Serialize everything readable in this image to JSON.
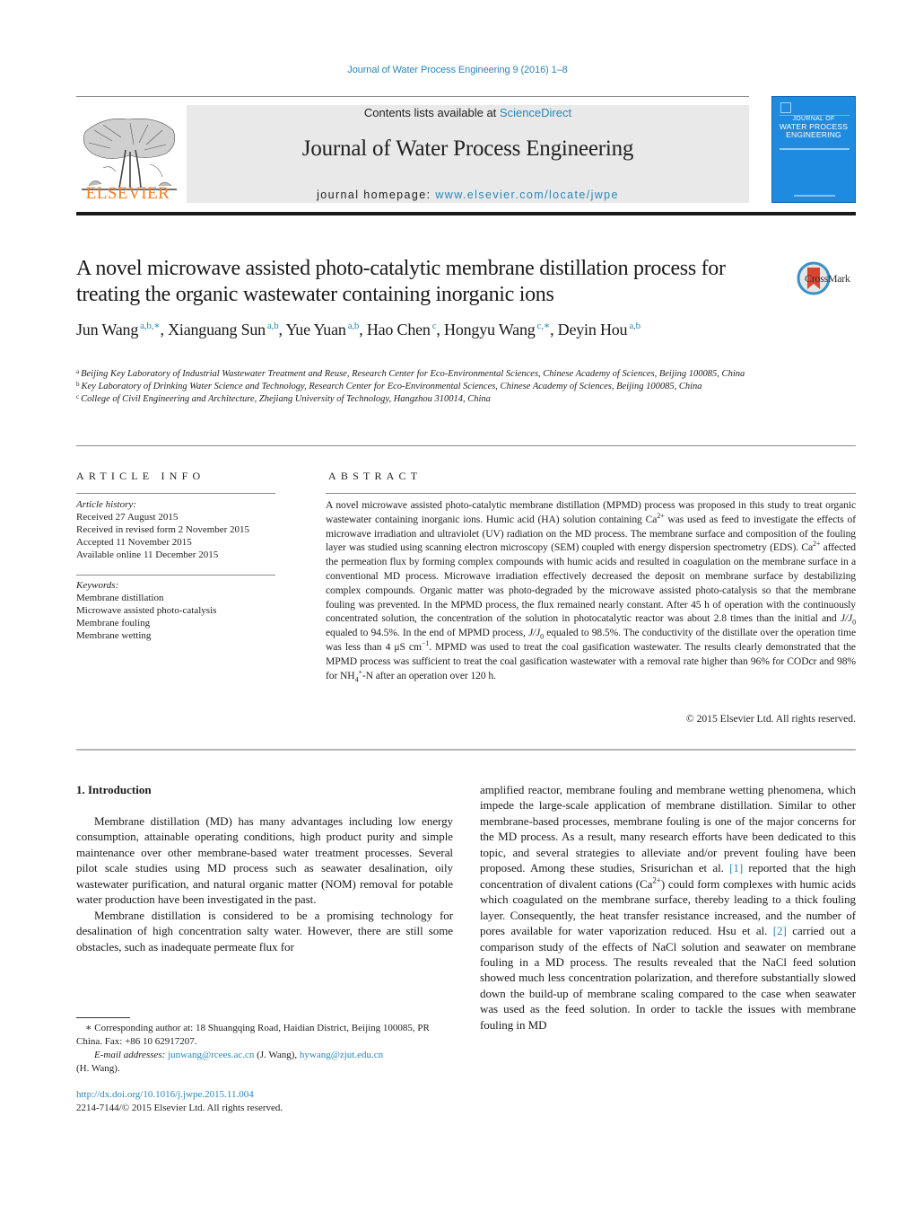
{
  "header": {
    "running_head": "Journal of Water Process Engineering 9 (2016) 1–8",
    "contents_prefix": "Contents lists available at ",
    "contents_link": "ScienceDirect",
    "journal_name": "Journal of Water Process Engineering",
    "homepage_prefix": "journal homepage: ",
    "homepage_link": "www.elsevier.com/locate/jwpe",
    "publisher_logo_text": "ELSEVIER",
    "cover": {
      "line1": "JOURNAL OF",
      "line2": "WATER PROCESS",
      "line3": "ENGINEERING",
      "color": "#1f8be0"
    },
    "publisher_color": "#f07e26",
    "link_color": "#2a86b8"
  },
  "article": {
    "title": "A novel microwave assisted photo-catalytic membrane distillation process for treating the organic wastewater containing inorganic ions",
    "crossmark_label": "CrossMark",
    "authors": [
      {
        "name": "Jun Wang",
        "sup": "a,b,∗"
      },
      {
        "name": "Xianguang Sun",
        "sup": "a,b"
      },
      {
        "name": "Yue Yuan",
        "sup": "a,b"
      },
      {
        "name": "Hao Chen",
        "sup": "c"
      },
      {
        "name": "Hongyu Wang",
        "sup": "c,∗"
      },
      {
        "name": "Deyin Hou",
        "sup": "a,b"
      }
    ],
    "affiliations": [
      {
        "mark": "a",
        "text": "Beijing Key Laboratory of Industrial Wastewater Treatment and Reuse, Research Center for Eco-Environmental Sciences, Chinese Academy of Sciences, Beijing 100085, China"
      },
      {
        "mark": "b",
        "text": "Key Laboratory of Drinking Water Science and Technology, Research Center for Eco-Environmental Sciences, Chinese Academy of Sciences, Beijing 100085, China"
      },
      {
        "mark": "c",
        "text": "College of Civil Engineering and Architecture, Zhejiang University of Technology, Hangzhou 310014, China"
      }
    ]
  },
  "article_info": {
    "heading": "ARTICLE INFO",
    "history_label": "Article history:",
    "history": [
      "Received 27 August 2015",
      "Received in revised form 2 November 2015",
      "Accepted 11 November 2015",
      "Available online 11 December 2015"
    ],
    "keywords_label": "Keywords:",
    "keywords": [
      "Membrane distillation",
      "Microwave assisted photo-catalysis",
      "Membrane fouling",
      "Membrane wetting"
    ]
  },
  "abstract": {
    "heading": "ABSTRACT",
    "parts": {
      "p1": "A novel microwave assisted photo-catalytic membrane distillation (MPMD) process was proposed in this study to treat organic wastewater containing inorganic ions. Humic acid (HA) solution containing Ca",
      "sup1": "2+",
      "p2": " was used as feed to investigate the effects of microwave irradiation and ultraviolet (UV) radiation on the MD process. The membrane surface and composition of the fouling layer was studied using scanning electron microscopy (SEM) coupled with energy dispersion spectrometry (EDS). Ca",
      "sup2": "2+",
      "p3": " affected the permeation flux by forming complex compounds with humic acids and resulted in coagulation on the membrane surface in a conventional MD process. Microwave irradiation effectively decreased the deposit on membrane surface by destabilizing complex compounds. Organic matter was photo-degraded by the microwave assisted photo-catalysis so that the membrane fouling was prevented. In the MPMD process, the flux remained nearly constant. After 45 h of operation with the continuously concentrated solution, the concentration of the solution in photocatalytic reactor was about 2.8 times than the initial and ",
      "ratio1": "J/J",
      "ratio1_sub": "0",
      "p4": " equaled to 94.5%. In the end of MPMD process, ",
      "ratio2": "J/J",
      "ratio2_sub": "0",
      "p5": " equaled to 98.5%. The conductivity of the distillate over the operation time was less than 4 μS cm",
      "sup3": "−1",
      "p6": ". MPMD was used to treat the coal gasification wastewater. The results clearly demonstrated that the MPMD process was sufficient to treat the coal gasification wastewater with a removal rate higher than 96% for CODcr and 98% for NH",
      "sub4": "4",
      "sup4": "+",
      "p7": "-N after an operation over 120 h."
    },
    "copyright": "© 2015 Elsevier Ltd. All rights reserved."
  },
  "body": {
    "section_heading": "1.  Introduction",
    "left_p1": "Membrane distillation (MD) has many advantages including low energy consumption, attainable operating conditions, high product purity and simple maintenance over other membrane-based water treatment processes. Several pilot scale studies using MD process such as seawater desalination, oily wastewater purification, and natural organic matter (NOM) removal for potable water production have been investigated in the past.",
    "left_p2": "Membrane distillation is considered to be a promising technology for desalination of high concentration salty water. However, there are still some obstacles, such as inadequate permeate flux for",
    "right_a": "amplified reactor, membrane fouling and membrane wetting phenomena, which impede the large-scale application of membrane distillation. Similar to other membrane-based processes, membrane fouling is one of the major concerns for the MD process. As a result, many research efforts have been dedicated to this topic, and several strategies to alleviate and/or prevent fouling have been proposed. Among these studies, Srisurichan et al. ",
    "ref1": "[1]",
    "right_b": " reported that the high concentration of divalent cations (Ca",
    "right_sup": "2+",
    "right_c": ") could form complexes with humic acids which coagulated on the membrane surface, thereby leading to a thick fouling layer. Consequently, the heat transfer resistance increased, and the number of pores available for water vaporization reduced. Hsu et al. ",
    "ref2": "[2]",
    "right_d": " carried out a comparison study of the effects of NaCl solution and seawater on membrane fouling in a MD process. The results revealed that the NaCl feed solution showed much less concentration polarization, and therefore substantially slowed down the build-up of membrane scaling compared to the case when seawater was used as the feed solution. In order to tackle the issues with membrane fouling in MD"
  },
  "footnotes": {
    "corresponding": "∗ Corresponding author at: 18 Shuangqing Road, Haidian District, Beijing 100085, PR China. Fax: +86 10 62917207.",
    "email_label": "E-mail addresses: ",
    "email1": "junwang@rcees.ac.cn",
    "email1_owner": " (J. Wang), ",
    "email2": "hywang@zjut.edu.cn",
    "email2_owner": "(H. Wang).",
    "doi": "http://dx.doi.org/10.1016/j.jwpe.2015.11.004",
    "issn": "2214-7144/© 2015 Elsevier Ltd. All rights reserved."
  }
}
